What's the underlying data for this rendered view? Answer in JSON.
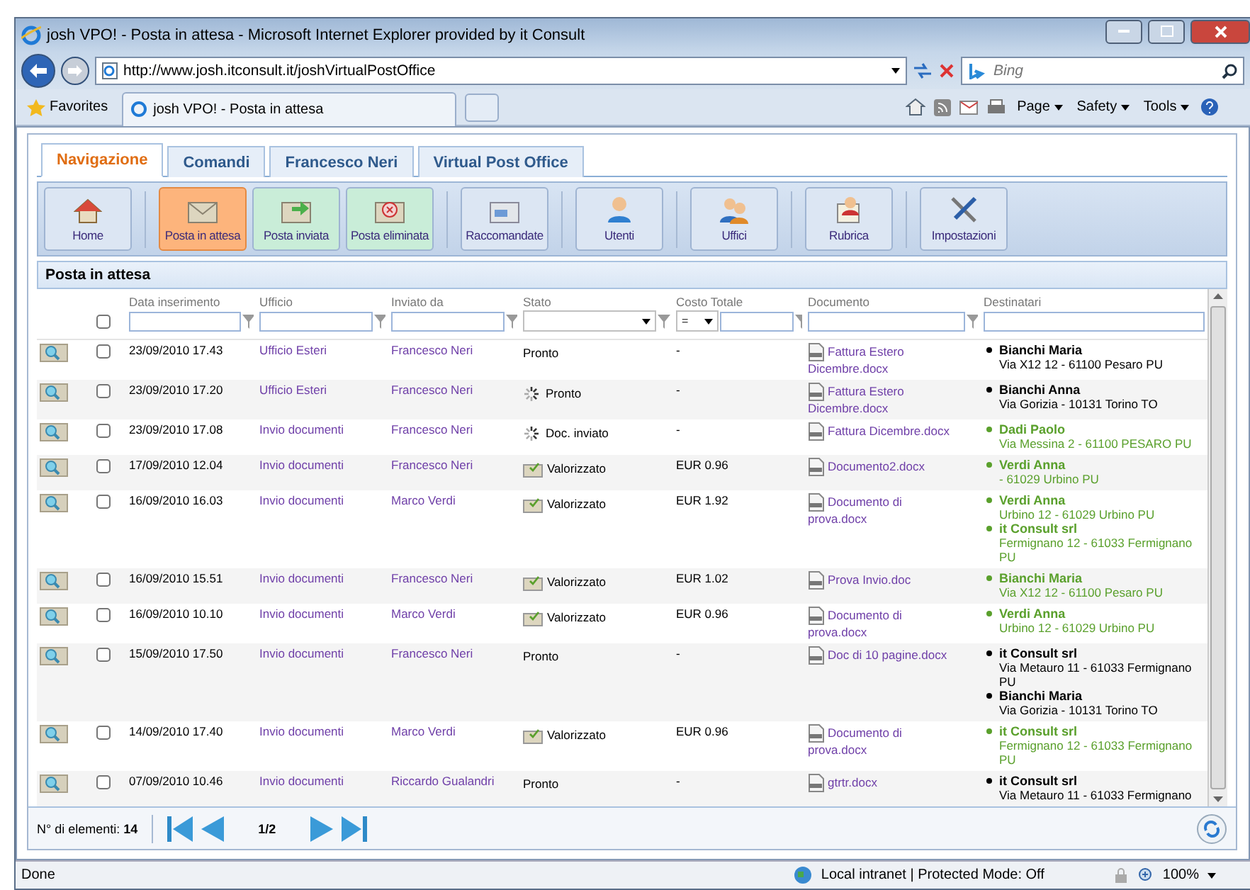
{
  "window": {
    "title": "josh VPO! - Posta in attesa - Microsoft Internet Explorer provided by it Consult"
  },
  "address_bar": {
    "url": "http://www.josh.itconsult.it/joshVirtualPostOffice",
    "search_placeholder": "Bing"
  },
  "favorites_bar": {
    "favorites": "Favorites",
    "tab": "josh VPO! - Posta in attesa",
    "commands": [
      "Page",
      "Safety",
      "Tools"
    ]
  },
  "tabs": [
    {
      "label": "Navigazione",
      "selected": true
    },
    {
      "label": "Comandi",
      "selected": false
    },
    {
      "label": "Francesco Neri",
      "selected": false
    },
    {
      "label": "Virtual Post Office",
      "selected": false
    }
  ],
  "toolbar": [
    {
      "label": "Home",
      "kind": "home",
      "selected": false,
      "color": "#dce6f3"
    },
    {
      "label": "Posta in attesa",
      "kind": "pending",
      "selected": true,
      "color": "#fdb47c"
    },
    {
      "label": "Posta inviata",
      "kind": "sent",
      "selected": false,
      "color": "#c9edd8"
    },
    {
      "label": "Posta eliminata",
      "kind": "deleted",
      "selected": false,
      "color": "#c9edd8"
    },
    {
      "label": "Raccomandate",
      "kind": "registered",
      "selected": false,
      "color": "#dce6f3"
    },
    {
      "label": "Utenti",
      "kind": "users",
      "selected": false,
      "color": "#dce6f3"
    },
    {
      "label": "Uffici",
      "kind": "offices",
      "selected": false,
      "color": "#dce6f3"
    },
    {
      "label": "Rubrica",
      "kind": "addressbook",
      "selected": false,
      "color": "#dce6f3"
    },
    {
      "label": "Impostazioni",
      "kind": "settings",
      "selected": false,
      "color": "#dce6f3"
    }
  ],
  "panel": {
    "title": "Posta in attesa"
  },
  "table": {
    "columns": [
      "Data inserimento",
      "Ufficio",
      "Inviato da",
      "Stato",
      "Costo Totale",
      "Documento",
      "Destinatari"
    ],
    "cost_operator": "=",
    "all_checked": false,
    "rows": [
      {
        "kind": "plain",
        "checked": false,
        "date": "23/09/2010 17.43",
        "office": "Ufficio Esteri",
        "sender": "Francesco Neri",
        "status": "Pronto",
        "cost": "-",
        "document": "Fattura Estero Dicembre.docx",
        "recipients": [
          {
            "name": "Bianchi Maria",
            "address": "Via X12 12 - 61100 Pesaro PU",
            "color": "#000000"
          }
        ]
      },
      {
        "kind": "working",
        "checked": false,
        "date": "23/09/2010 17.20",
        "office": "Ufficio Esteri",
        "sender": "Francesco Neri",
        "status": "Pronto",
        "cost": "-",
        "document": "Fattura Estero Dicembre.docx",
        "recipients": [
          {
            "name": "Bianchi Anna",
            "address": "Via Gorizia - 10131 Torino TO",
            "color": "#000000"
          }
        ]
      },
      {
        "kind": "working",
        "checked": false,
        "date": "23/09/2010 17.08",
        "office": "Invio documenti",
        "sender": "Francesco Neri",
        "status": "Doc. inviato",
        "cost": "-",
        "document": "Fattura Dicembre.docx",
        "recipients": [
          {
            "name": "Dadi Paolo",
            "address": "Via Messina 2 - 61100 PESARO PU",
            "color": "#5aa02c"
          }
        ]
      },
      {
        "kind": "valued",
        "checked": false,
        "date": "17/09/2010 12.04",
        "office": "Invio documenti",
        "sender": "Francesco Neri",
        "status": "Valorizzato",
        "cost": "EUR 0.96",
        "document": "Documento2.docx",
        "recipients": [
          {
            "name": "Verdi Anna",
            "address": "- 61029 Urbino PU",
            "color": "#5aa02c"
          }
        ]
      },
      {
        "kind": "valued",
        "checked": false,
        "date": "16/09/2010 16.03",
        "office": "Invio documenti",
        "sender": "Marco Verdi",
        "status": "Valorizzato",
        "cost": "EUR 1.92",
        "document": "Documento di prova.docx",
        "recipients": [
          {
            "name": "Verdi Anna",
            "address": "Urbino 12 - 61029 Urbino PU",
            "color": "#5aa02c"
          },
          {
            "name": "it Consult srl",
            "address": "Fermignano 12 - 61033 Fermignano PU",
            "color": "#5aa02c"
          }
        ]
      },
      {
        "kind": "valued",
        "checked": false,
        "date": "16/09/2010 15.51",
        "office": "Invio documenti",
        "sender": "Francesco Neri",
        "status": "Valorizzato",
        "cost": "EUR 1.02",
        "document": "Prova Invio.doc",
        "recipients": [
          {
            "name": "Bianchi Maria",
            "address": "Via X12 12 - 61100 Pesaro PU",
            "color": "#5aa02c"
          }
        ]
      },
      {
        "kind": "valued",
        "checked": false,
        "date": "16/09/2010 10.10",
        "office": "Invio documenti",
        "sender": "Marco Verdi",
        "status": "Valorizzato",
        "cost": "EUR 0.96",
        "document": "Documento di prova.docx",
        "recipients": [
          {
            "name": "Verdi Anna",
            "address": "Urbino 12 - 61029 Urbino PU",
            "color": "#5aa02c"
          }
        ]
      },
      {
        "kind": "plain",
        "checked": false,
        "date": "15/09/2010 17.50",
        "office": "Invio documenti",
        "sender": "Francesco Neri",
        "status": "Pronto",
        "cost": "-",
        "document": "Doc di 10 pagine.docx",
        "recipients": [
          {
            "name": "it Consult srl",
            "address": "Via Metauro 11 - 61033 Fermignano PU",
            "color": "#000000"
          },
          {
            "name": "Bianchi Maria",
            "address": "Via Gorizia - 10131 Torino TO",
            "color": "#000000"
          }
        ]
      },
      {
        "kind": "valued",
        "checked": false,
        "date": "14/09/2010 17.40",
        "office": "Invio documenti",
        "sender": "Marco Verdi",
        "status": "Valorizzato",
        "cost": "EUR 0.96",
        "document": "Documento di prova.docx",
        "recipients": [
          {
            "name": "it Consult srl",
            "address": "Fermignano 12 - 61033 Fermignano PU",
            "color": "#5aa02c"
          }
        ]
      },
      {
        "kind": "plain",
        "checked": false,
        "date": "07/09/2010 10.46",
        "office": "Invio documenti",
        "sender": "Riccardo Gualandri",
        "status": "Pronto",
        "cost": "-",
        "document": "gtrtr.docx",
        "recipients": [
          {
            "name": "it Consult srl",
            "address": "Via Metauro 11 - 61033 Fermignano",
            "color": "#000000"
          }
        ]
      }
    ]
  },
  "pager": {
    "label": "N° di elementi:",
    "count": "14",
    "page": "1/2"
  },
  "status_bar": {
    "text": "Done",
    "zone": "Local intranet | Protected Mode: Off",
    "zoom": "100%"
  }
}
